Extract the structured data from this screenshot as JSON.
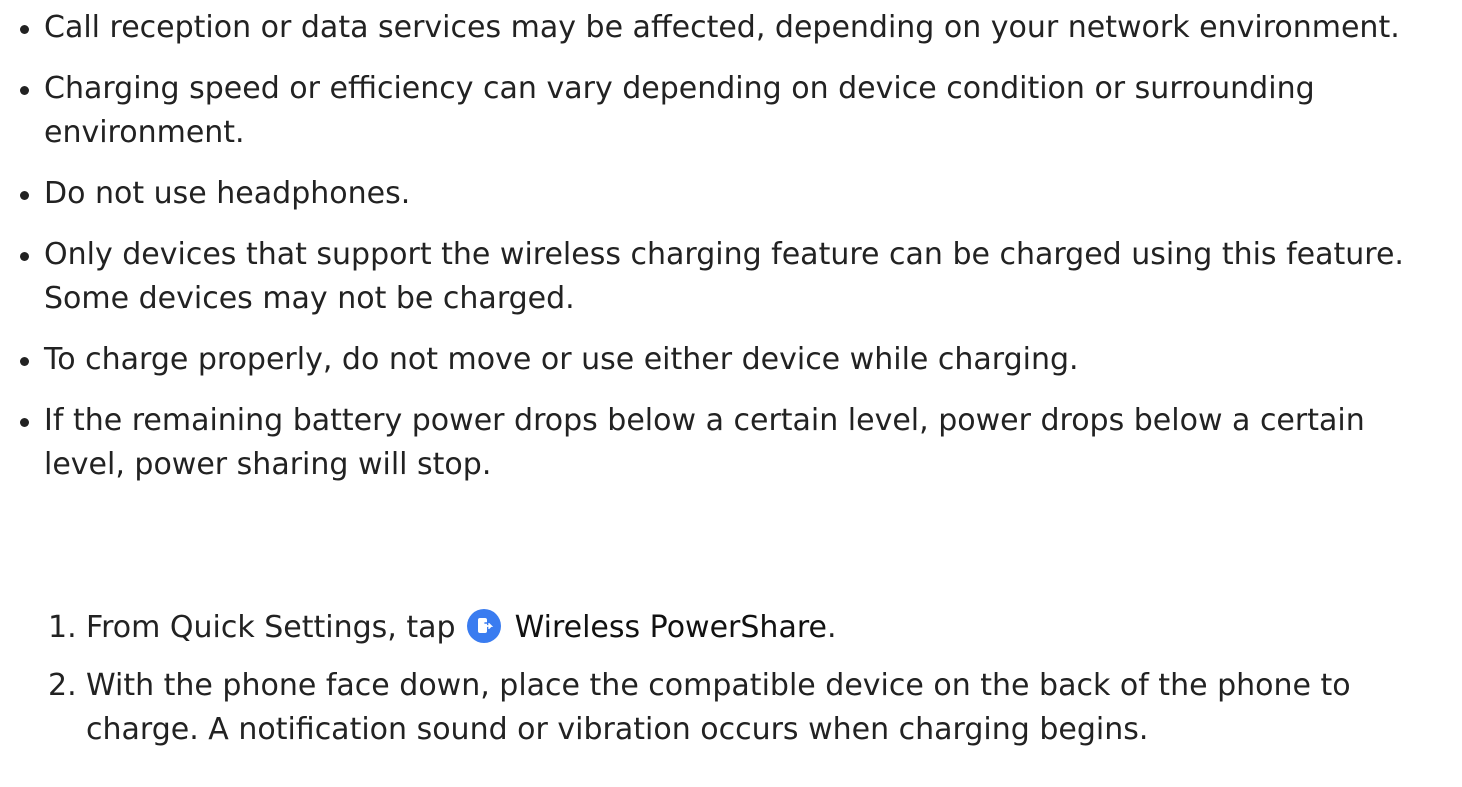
{
  "bullets": [
    {
      "text": "Call reception or data services may be affected, depending on your network environment."
    },
    {
      "text": "Charging speed or efficiency can vary depending on device condition or surrounding environment."
    },
    {
      "text": "Do not use headphones."
    },
    {
      "text": "Only devices that support the wireless charging feature can be charged using this feature. Some devices may not be charged."
    },
    {
      "text": "To charge properly, do not move or use either device while charging."
    },
    {
      "text": "If the remaining battery power drops below a certain level, power drops below a certain level, power sharing will stop."
    }
  ],
  "steps": [
    {
      "number": "1.",
      "prefix": "From Quick Settings, tap ",
      "icon": "wireless-powershare-icon",
      "emphasis": "Wireless PowerShare",
      "suffix": "."
    },
    {
      "number": "2.",
      "text": "With the phone face down, place the compatible device on the back of the phone to charge. A notification sound or vibration occurs when charging begins."
    }
  ],
  "colors": {
    "text": "#222222",
    "icon_bg": "#3a7cf0"
  }
}
